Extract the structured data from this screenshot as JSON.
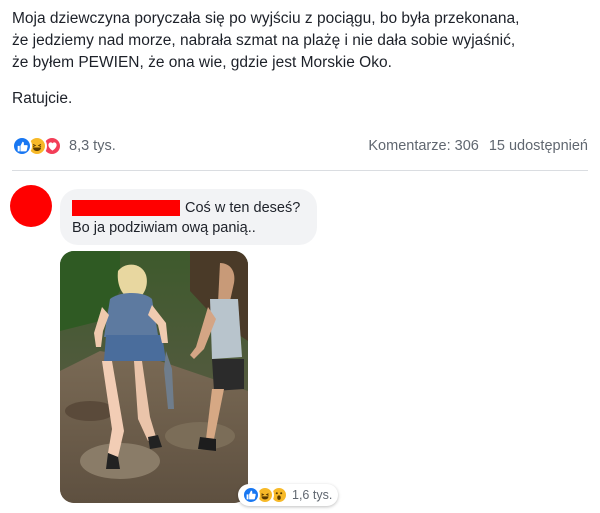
{
  "post": {
    "text_lines": [
      "Moja dziewczyna poryczała się po wyjściu z pociągu, bo była przekonana,",
      "że jedziemy nad morze, nabrała szmat na plażę i nie dała sobie wyjaśnić,",
      "że byłem PEWIEN, że ona wie, gdzie jest Morskie Oko."
    ],
    "text_p2": "Ratujcie.",
    "reaction_count": "8,3 tys.",
    "reaction_icons": [
      "like-icon",
      "haha-icon",
      "love-icon"
    ],
    "comments": "Komentarze: 306",
    "shares": "15 udostępnień"
  },
  "comment": {
    "line1": "Coś w ten deseś?",
    "line2": "Bo ja podziwiam ową panią..",
    "photo_reaction_count": "1,6 tys.",
    "photo_reaction_icons": [
      "like-icon",
      "haha-icon",
      "wow-icon"
    ]
  },
  "colors": {
    "like": "#1877f2",
    "haha": "#f7b928",
    "love": "#f33e58",
    "redaction": "#ff0000",
    "bubble": "#f2f3f5"
  }
}
